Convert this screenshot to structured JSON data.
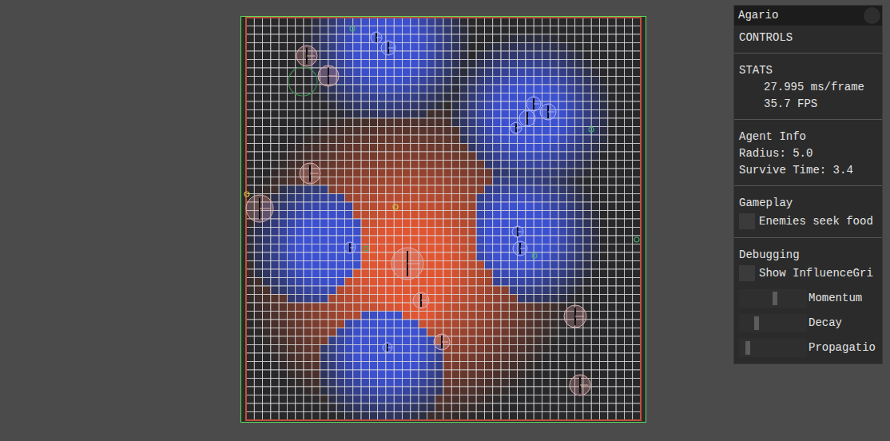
{
  "panel": {
    "title": "Agario",
    "controls_header": "CONTROLS",
    "stats": {
      "header": "STATS",
      "lines": [
        "27.995 ms/frame",
        "35.7 FPS"
      ]
    },
    "agent_info": {
      "header": "Agent Info",
      "lines": [
        "Radius: 5.0",
        "Survive Time: 3.4"
      ]
    },
    "gameplay": {
      "header": "Gameplay",
      "items": [
        {
          "kind": "checkbox",
          "label": "Enemies seek food",
          "checked": false
        }
      ]
    },
    "debugging": {
      "header": "Debugging",
      "items": [
        {
          "kind": "checkbox",
          "label": "Show InfluenceGri",
          "checked": false
        },
        {
          "kind": "slider",
          "label": "Momentum",
          "level": 0.53
        },
        {
          "kind": "slider",
          "label": "Decay",
          "level": 0.22
        },
        {
          "kind": "slider",
          "label": "Propagatio",
          "level": 0.08
        }
      ]
    }
  }
}
